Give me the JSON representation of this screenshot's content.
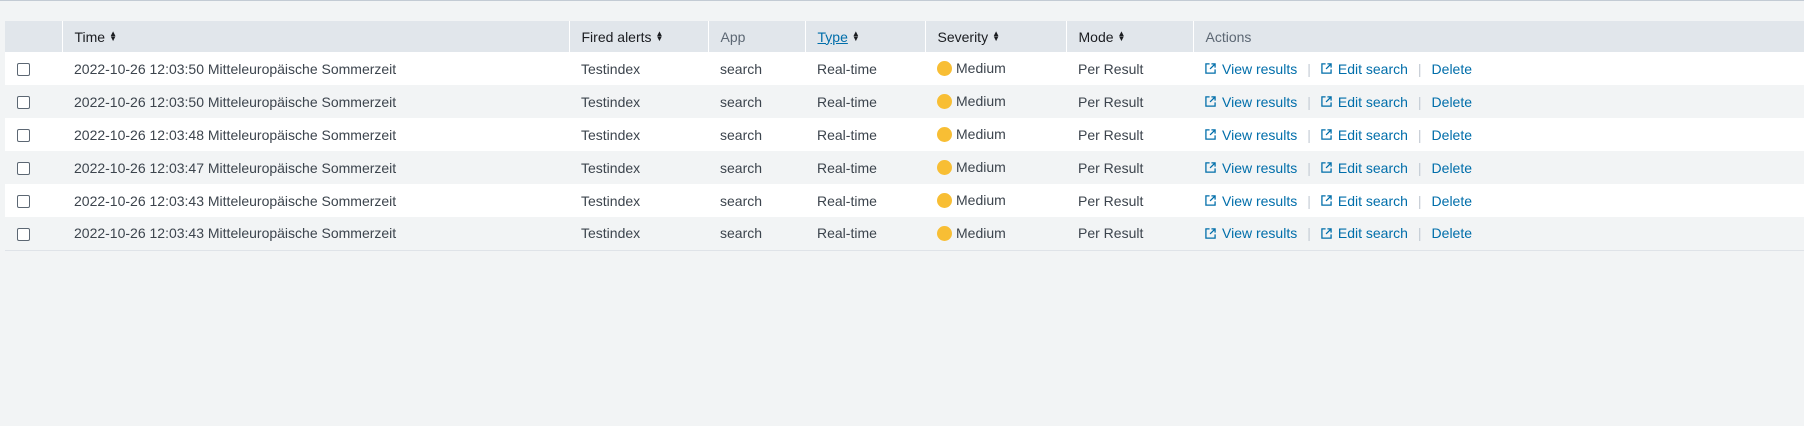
{
  "columns": {
    "time": "Time",
    "fired_alerts": "Fired alerts",
    "app": "App",
    "type": "Type",
    "severity": "Severity",
    "mode": "Mode",
    "actions": "Actions"
  },
  "colors": {
    "severity_medium": "#f8be34",
    "link": "#006eaa",
    "header_bg": "#e1e6eb"
  },
  "rows": [
    {
      "time": "2022-10-26 12:03:50 Mitteleuropäische Sommerzeit",
      "fired_alert": "Testindex",
      "app": "search",
      "type": "Real-time",
      "severity": "Medium",
      "mode": "Per Result",
      "view_results": "View results",
      "edit_search": "Edit search",
      "delete": "Delete"
    },
    {
      "time": "2022-10-26 12:03:50 Mitteleuropäische Sommerzeit",
      "fired_alert": "Testindex",
      "app": "search",
      "type": "Real-time",
      "severity": "Medium",
      "mode": "Per Result",
      "view_results": "View results",
      "edit_search": "Edit search",
      "delete": "Delete"
    },
    {
      "time": "2022-10-26 12:03:48 Mitteleuropäische Sommerzeit",
      "fired_alert": "Testindex",
      "app": "search",
      "type": "Real-time",
      "severity": "Medium",
      "mode": "Per Result",
      "view_results": "View results",
      "edit_search": "Edit search",
      "delete": "Delete"
    },
    {
      "time": "2022-10-26 12:03:47 Mitteleuropäische Sommerzeit",
      "fired_alert": "Testindex",
      "app": "search",
      "type": "Real-time",
      "severity": "Medium",
      "mode": "Per Result",
      "view_results": "View results",
      "edit_search": "Edit search",
      "delete": "Delete"
    },
    {
      "time": "2022-10-26 12:03:43 Mitteleuropäische Sommerzeit",
      "fired_alert": "Testindex",
      "app": "search",
      "type": "Real-time",
      "severity": "Medium",
      "mode": "Per Result",
      "view_results": "View results",
      "edit_search": "Edit search",
      "delete": "Delete"
    },
    {
      "time": "2022-10-26 12:03:43 Mitteleuropäische Sommerzeit",
      "fired_alert": "Testindex",
      "app": "search",
      "type": "Real-time",
      "severity": "Medium",
      "mode": "Per Result",
      "view_results": "View results",
      "edit_search": "Edit search",
      "delete": "Delete"
    }
  ]
}
